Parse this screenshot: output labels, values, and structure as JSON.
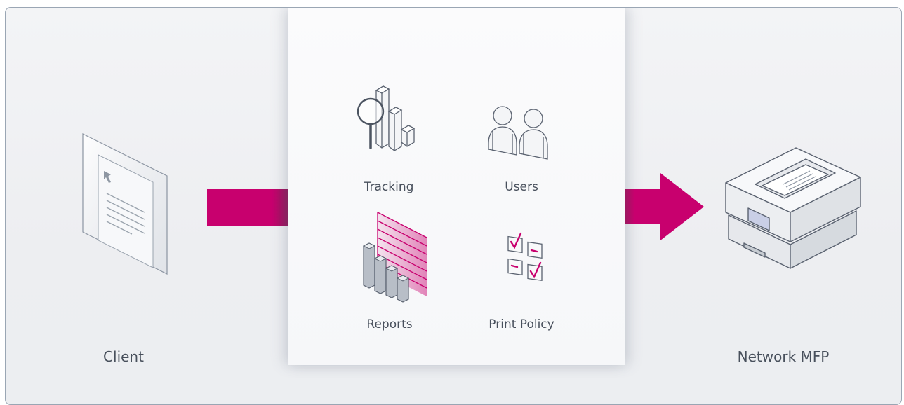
{
  "diagram": {
    "client": {
      "label": "Client"
    },
    "features": [
      {
        "label": "Tracking",
        "icon": "tracking-magnifier-chart-icon"
      },
      {
        "label": "Users",
        "icon": "users-icon"
      },
      {
        "label": "Reports",
        "icon": "reports-chart-icon"
      },
      {
        "label": "Print Policy",
        "icon": "print-policy-checklist-icon"
      }
    ],
    "destination": {
      "label": "Network MFP",
      "icon": "printer-icon"
    },
    "colors": {
      "accent": "#c8006e",
      "line": "#5a6270",
      "text": "#48505c",
      "background": "#eef0f3",
      "panel": "#f8f9fa"
    }
  }
}
